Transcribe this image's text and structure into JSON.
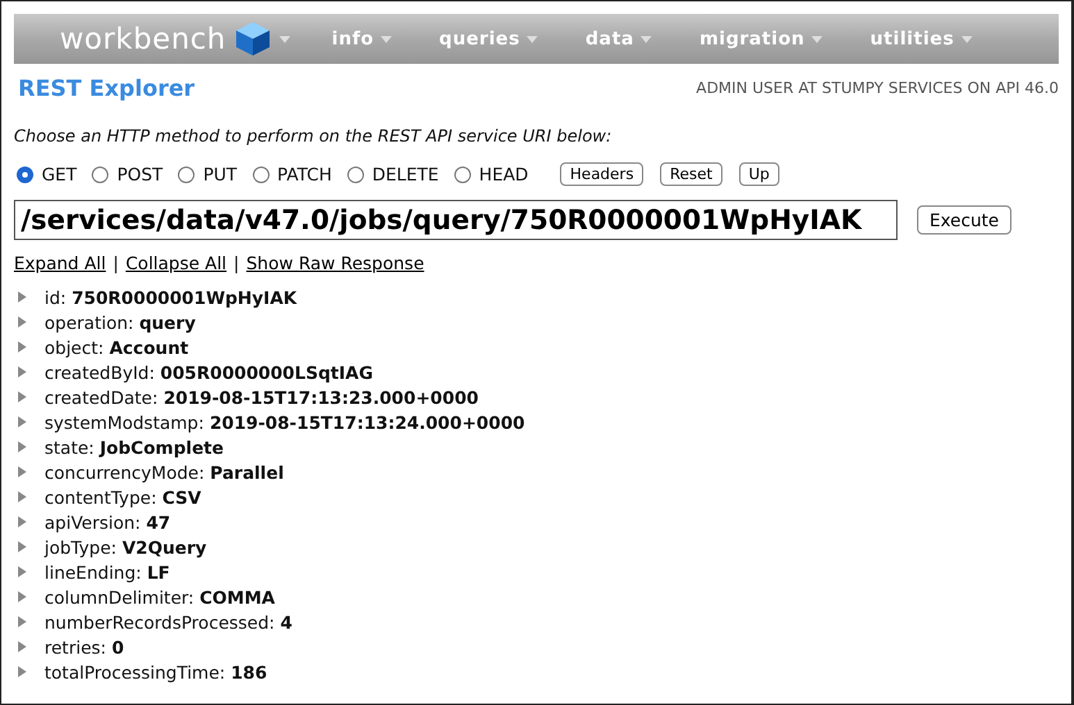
{
  "nav": {
    "logo": "workbench",
    "menus": [
      {
        "label": "info"
      },
      {
        "label": "queries"
      },
      {
        "label": "data"
      },
      {
        "label": "migration"
      },
      {
        "label": "utilities"
      }
    ]
  },
  "header": {
    "title": "REST Explorer",
    "user": "ADMIN USER AT STUMPY SERVICES ON API 46.0"
  },
  "instruction": "Choose an HTTP method to perform on the REST API service URI below:",
  "methods": [
    {
      "label": "GET",
      "selected": true
    },
    {
      "label": "POST",
      "selected": false
    },
    {
      "label": "PUT",
      "selected": false
    },
    {
      "label": "PATCH",
      "selected": false
    },
    {
      "label": "DELETE",
      "selected": false
    },
    {
      "label": "HEAD",
      "selected": false
    }
  ],
  "method_buttons": [
    "Headers",
    "Reset",
    "Up"
  ],
  "uri": {
    "value": "/services/data/v47.0/jobs/query/750R0000001WpHyIAK"
  },
  "execute_button": "Execute",
  "links": [
    "Expand All",
    "Collapse All",
    "Show Raw Response"
  ],
  "link_separator": "|",
  "fields": [
    {
      "text": "id: **750R0000001WpHyIAK**"
    },
    {
      "text": "operation: **query**"
    },
    {
      "text": "object: **Account**"
    },
    {
      "text": "createdById: **005R0000000LSqtIAG**"
    },
    {
      "text": "createdDate: **2019-08-15T17:13:23.000+0000**"
    },
    {
      "text": "systemModstamp: **2019-08-15T17:13:24.000+0000**"
    },
    {
      "text": "state: **JobComplete**"
    },
    {
      "text": "concurrencyMode: **Parallel**"
    },
    {
      "text": "contentType: **CSV**"
    },
    {
      "text": "apiVersion: **47**"
    },
    {
      "text": "jobType: **V2Query**"
    },
    {
      "text": "lineEnding: **LF**"
    },
    {
      "text": "columnDelimiter: **COMMA**"
    },
    {
      "text": "numberRecordsProcessed: **4**"
    },
    {
      "text": "retries: **0**"
    },
    {
      "text": "totalProcessingTime: **186**"
    }
  ]
}
